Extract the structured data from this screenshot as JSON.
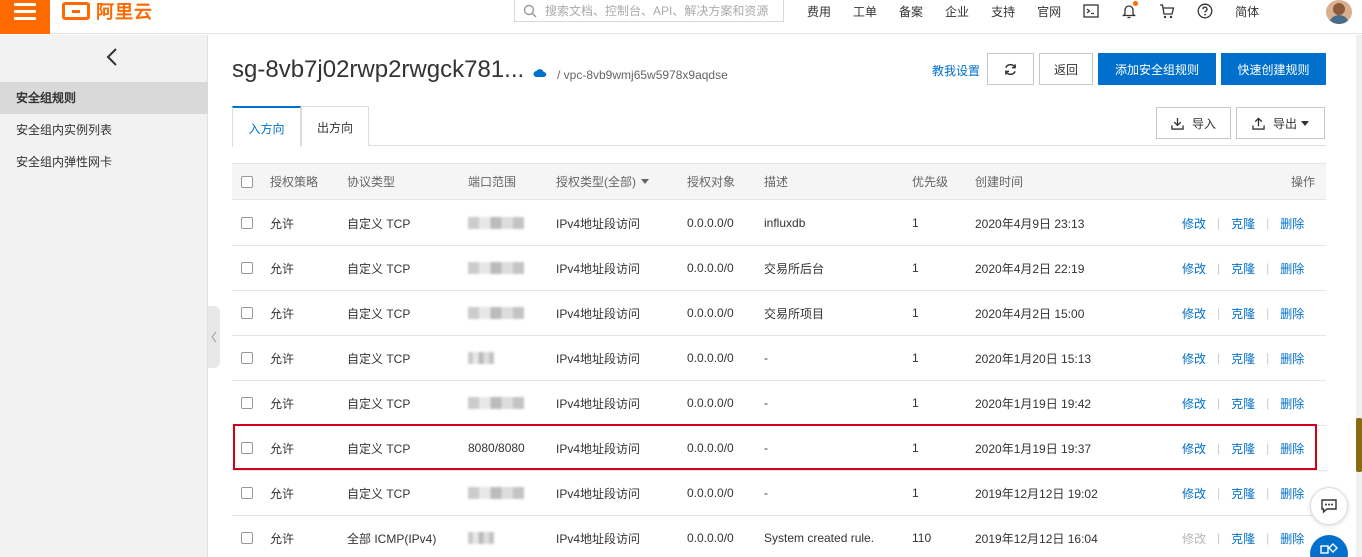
{
  "topbar": {
    "logo_text": "阿里云",
    "search_placeholder": "搜索文档、控制台、API、解决方案和资源",
    "nav": [
      "费用",
      "工单",
      "备案",
      "企业",
      "支持",
      "官网"
    ],
    "lang": "简体"
  },
  "sidebar": {
    "items": [
      {
        "label": "安全组规则",
        "active": true
      },
      {
        "label": "安全组内实例列表",
        "active": false
      },
      {
        "label": "安全组内弹性网卡",
        "active": false
      }
    ]
  },
  "header": {
    "title": "sg-8vb7j02rwp2rwgck781...",
    "vpc_path": "/ vpc-8vb9wmj65w5978x9aqdse",
    "help_link": "教我设置",
    "back_label": "返回",
    "add_rule_label": "添加安全组规则",
    "quick_create_label": "快速创建规则",
    "import_label": "导入",
    "export_label": "导出"
  },
  "tabs": [
    {
      "label": "入方向",
      "active": true
    },
    {
      "label": "出方向",
      "active": false
    }
  ],
  "table": {
    "columns": [
      "授权策略",
      "协议类型",
      "端口范围",
      "授权类型(全部)",
      "授权对象",
      "描述",
      "优先级",
      "创建时间",
      "操作"
    ],
    "op_labels": {
      "edit": "修改",
      "clone": "克隆",
      "delete": "删除"
    },
    "rows": [
      {
        "policy": "允许",
        "protocol": "自定义 TCP",
        "port": "",
        "port_hidden": true,
        "auth_type": "IPv4地址段访问",
        "target": "0.0.0.0/0",
        "desc": "influxdb",
        "priority": "1",
        "created": "2020年4月9日 23:13",
        "edit_disabled": false
      },
      {
        "policy": "允许",
        "protocol": "自定义 TCP",
        "port": "",
        "port_hidden": true,
        "auth_type": "IPv4地址段访问",
        "target": "0.0.0.0/0",
        "desc": "交易所后台",
        "priority": "1",
        "created": "2020年4月2日 22:19",
        "edit_disabled": false
      },
      {
        "policy": "允许",
        "protocol": "自定义 TCP",
        "port": "",
        "port_hidden": true,
        "auth_type": "IPv4地址段访问",
        "target": "0.0.0.0/0",
        "desc": "交易所项目",
        "priority": "1",
        "created": "2020年4月2日 15:00",
        "edit_disabled": false
      },
      {
        "policy": "允许",
        "protocol": "自定义 TCP",
        "port": "",
        "port_hidden": true,
        "auth_type": "IPv4地址段访问",
        "target": "0.0.0.0/0",
        "desc": "-",
        "priority": "1",
        "created": "2020年1月20日 15:13",
        "edit_disabled": false
      },
      {
        "policy": "允许",
        "protocol": "自定义 TCP",
        "port": "",
        "port_hidden": true,
        "auth_type": "IPv4地址段访问",
        "target": "0.0.0.0/0",
        "desc": "-",
        "priority": "1",
        "created": "2020年1月19日 19:42",
        "edit_disabled": false
      },
      {
        "policy": "允许",
        "protocol": "自定义 TCP",
        "port": "8080/8080",
        "port_hidden": false,
        "auth_type": "IPv4地址段访问",
        "target": "0.0.0.0/0",
        "desc": "-",
        "priority": "1",
        "created": "2020年1月19日 19:37",
        "edit_disabled": false
      },
      {
        "policy": "允许",
        "protocol": "自定义 TCP",
        "port": "",
        "port_hidden": true,
        "auth_type": "IPv4地址段访问",
        "target": "0.0.0.0/0",
        "desc": "-",
        "priority": "1",
        "created": "2019年12月12日 19:02",
        "edit_disabled": false
      },
      {
        "policy": "允许",
        "protocol": "全部 ICMP(IPv4)",
        "port": "",
        "port_hidden": true,
        "auth_type": "IPv4地址段访问",
        "target": "0.0.0.0/0",
        "desc": "System created rule.",
        "priority": "110",
        "created": "2019年12月12日 16:04",
        "edit_disabled": true
      }
    ]
  },
  "colors": {
    "brand": "#ff6a00",
    "primary": "#0070cc",
    "highlight": "#d0021b"
  }
}
